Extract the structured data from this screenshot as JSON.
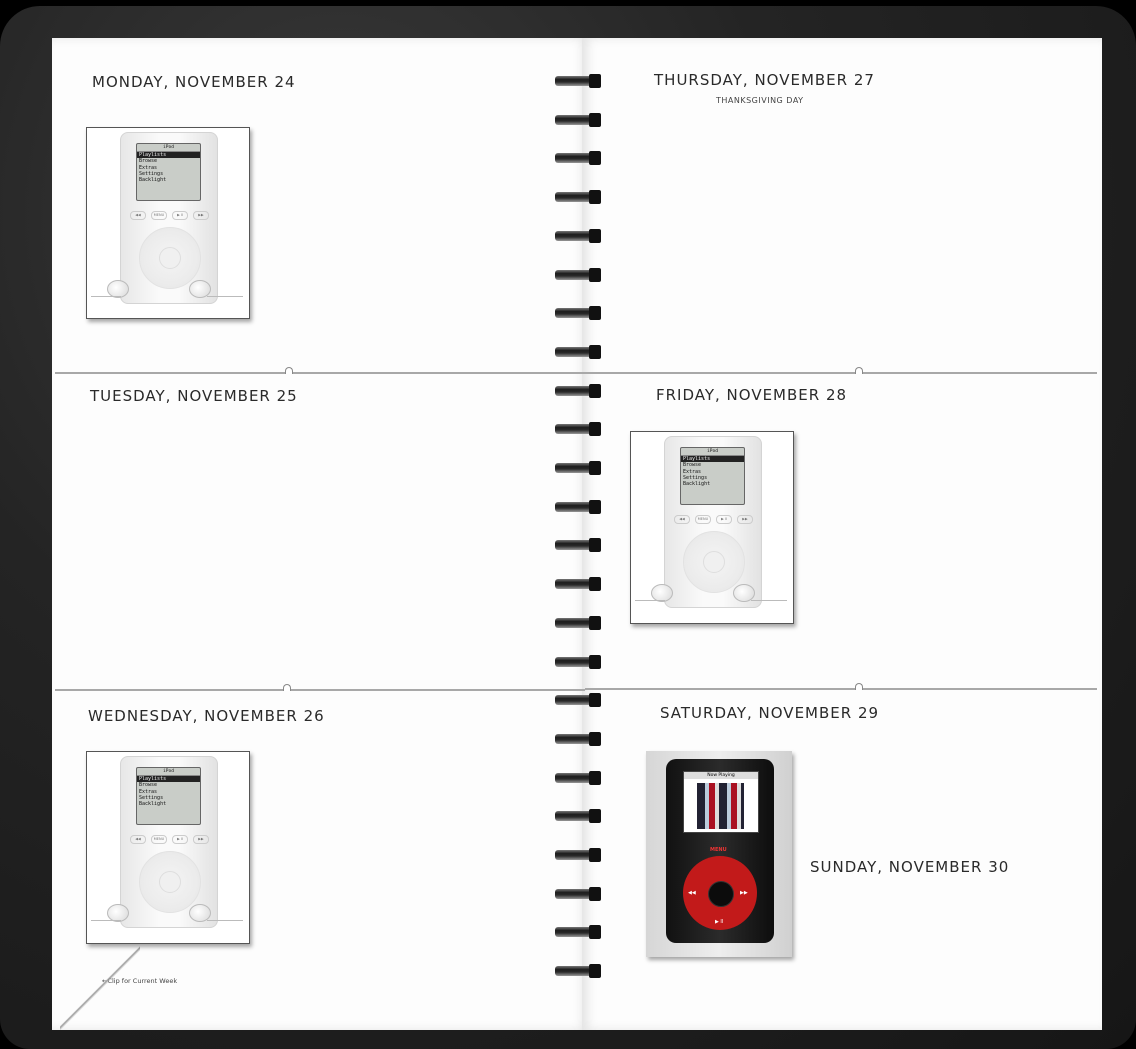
{
  "left_page": {
    "days": [
      {
        "label": "MONDAY,  NOVEMBER  24"
      },
      {
        "label": "TUESDAY,  NOVEMBER  25"
      },
      {
        "label": "WEDNESDAY,  NOVEMBER  26"
      }
    ],
    "clip_note": "←Clip for Current Week"
  },
  "right_page": {
    "days": [
      {
        "label": "THURSDAY,  NOVEMBER  27",
        "note": "THANKSGIVING DAY"
      },
      {
        "label": "FRIDAY,  NOVEMBER  28"
      },
      {
        "label": "SATURDAY,  NOVEMBER  29"
      },
      {
        "label": "SUNDAY,  NOVEMBER  30"
      }
    ]
  },
  "ipod_classic": {
    "title": "iPod",
    "menu": [
      "Playlists",
      "Browse",
      "Extras",
      "Settings",
      "Backlight"
    ],
    "buttons": [
      "◀◀",
      "MENU",
      "▶ II",
      "▶▶"
    ]
  },
  "ipod_u2": {
    "screen_title": "Now Playing",
    "menu_label": "MENU",
    "prev": "◀◀",
    "next": "▶▶",
    "play": "▶ II"
  }
}
